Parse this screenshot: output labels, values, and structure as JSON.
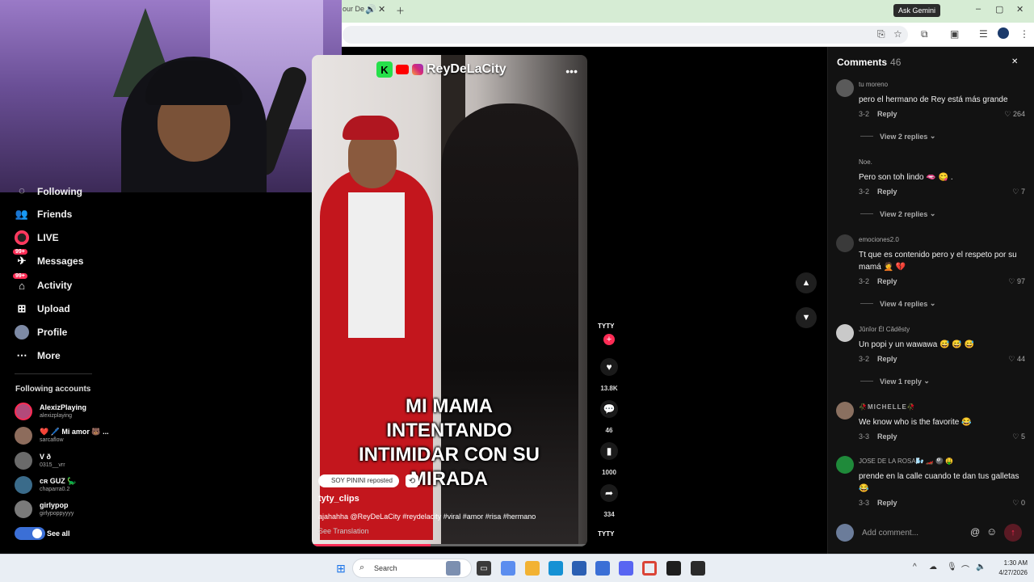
{
  "browser": {
    "tab_fragment": "our De",
    "overlay_badge": "Ask Gemini"
  },
  "sidebar": {
    "partial_item": "Following",
    "items": [
      {
        "label": "Friends"
      },
      {
        "label": "LIVE"
      },
      {
        "label": "Messages",
        "badge": "99+"
      },
      {
        "label": "Activity",
        "badge": "99+"
      },
      {
        "label": "Upload"
      },
      {
        "label": "Profile"
      },
      {
        "label": "More"
      }
    ],
    "following_title": "Following accounts",
    "following": [
      {
        "name": "AlexizPlaying",
        "user": "alexizplaying"
      },
      {
        "name": "❤️ 🖊️ Mi amor 🐻 ...",
        "user": "sarcaflow"
      },
      {
        "name": "V ð",
        "user": "0315__vrr"
      },
      {
        "name": "cʀ GUZ 🦕",
        "user": "chaparra0.2"
      },
      {
        "name": "girlypop",
        "user": "girlypoppyyyy"
      }
    ],
    "see_all": "See all"
  },
  "video": {
    "handle": "ReyDeLaCity",
    "caption_line1": "MI MAMA INTENTANDO",
    "caption_line2": "INTIMIDAR CON SU MIRADA",
    "repost_label": "SOY PININI reposted",
    "author": "tyty_clips",
    "description": "ajahahha @ReyDeLaCity #reydelacity #viral #amor #risa #hermano",
    "see_translation": "See Translation",
    "progress": 0.43
  },
  "actions": {
    "creator": "TYTY",
    "likes": "13.8K",
    "comments": "46",
    "saves": "1000",
    "shares": "334",
    "sound": "TYTY"
  },
  "comments": {
    "title": "Comments",
    "count": "46",
    "items": [
      {
        "user": "tu moreno",
        "text": "pero el hermano de Rey está más grande",
        "date": "3-2",
        "likes": "264",
        "view_replies": "View 2 replies"
      },
      {
        "user": "Noe.",
        "text": "Pero son toh lindo 🫦 😋 .",
        "date": "3-2",
        "likes": "7",
        "view_replies": "View 2 replies"
      },
      {
        "user": "emociones2.0",
        "text": "Tt que es contenido pero y el respeto por su mamá 🤦 💔",
        "date": "3-2",
        "likes": "97",
        "view_replies": "View 4 replies"
      },
      {
        "user": "Jŭnĭor Él Cădĕsty",
        "text": "Un popi y un wawawa 😅 😅 😅",
        "date": "3-2",
        "likes": "44",
        "view_replies": "View 1 reply"
      },
      {
        "user": "🥀MICHELLE🥀",
        "text": "We know who is the favorite 😂",
        "date": "3-3",
        "likes": "5"
      },
      {
        "user": "JOSE DE LA ROSA🌬️ 🏎️ 🎱 🤑",
        "text": "prende en la calle cuando te dan tus galletas 😂",
        "date": "3-3",
        "likes": "0"
      }
    ],
    "reply_label": "Reply",
    "input_placeholder": "Add comment..."
  },
  "taskbar": {
    "search_placeholder": "Search",
    "time": "1:30 AM",
    "date": "4/27/2026"
  }
}
